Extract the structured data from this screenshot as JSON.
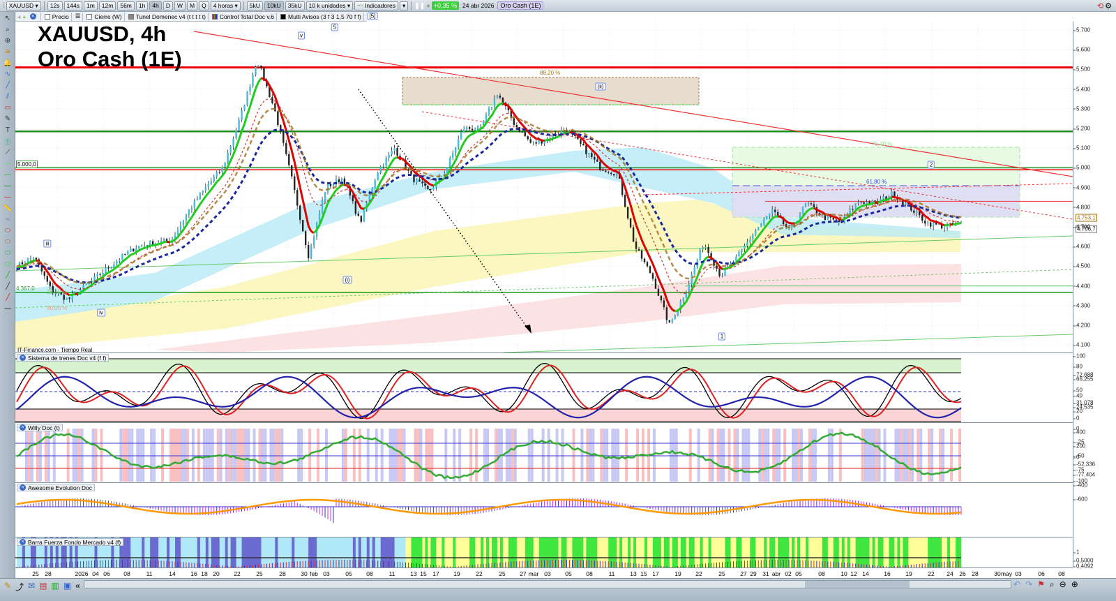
{
  "toolbar": {
    "symbol": "XAUUSD",
    "timeframes": [
      "12s",
      "144s",
      "1m",
      "12m",
      "56m",
      "1h",
      "4h",
      "D",
      "W",
      "M",
      "Q"
    ],
    "active_timeframe": "4h",
    "period": "4 horas",
    "units": [
      "5kU",
      "10kU",
      "35kU"
    ],
    "active_unit": "10kU",
    "unit_select": "10 k unidades",
    "indicators": "Indicadores",
    "change": "+0,35 %",
    "date": "24 abr 2026",
    "instrument": "Oro Cash (1E)"
  },
  "legend_row": {
    "items": [
      "Precio",
      "Cierre (W)",
      "Tunel Domenec v4 (t t t t t)",
      "Control Total Doc v.6",
      "Multi Avisos (3 f 3 1,5 70 f f)"
    ],
    "wave_top": "[5]"
  },
  "title": {
    "line1": "XAUUSD, 4h",
    "line2": "Oro Cash (1E)"
  },
  "source": "IT-Finance.com - Tiempo Real",
  "annotations": {
    "fib_882": "88,20 %",
    "fib_764": "76,40 %",
    "fib_618": "61,80 %",
    "fib_382": "38,20 %",
    "fib_50": "50,00 %",
    "level_5000": "5.000,0",
    "level_4367": "4.367,0",
    "waves": {
      "v": "v",
      "w5": "5",
      "ii": "(ii)",
      "w2": "2",
      "iii": "iii",
      "iv": "iv",
      "i": "(i)",
      "w1": "1"
    }
  },
  "price_axis": {
    "ticks": [
      "5.700",
      "5.600",
      "5.500",
      "5.400",
      "5.300",
      "5.200",
      "5.100",
      "5.000",
      "4.900",
      "4.800",
      "4.700",
      "4.600",
      "4.500",
      "4.400",
      "4.300",
      "4.200",
      "4.100"
    ],
    "tag_upper": "4.753,1",
    "tag_last": "4.706,7"
  },
  "panes": [
    {
      "name": "Sistema de trenes Doc v4 (f f)",
      "ticks": [
        "100",
        "80",
        "72,688",
        "66,255",
        "50",
        "40",
        "31,078",
        "24,535",
        "20",
        "0"
      ]
    },
    {
      "name": "Willy Doc (t)",
      "ticks": [
        "0",
        "-25",
        "-50",
        "-75",
        "-77,404",
        "-100"
      ]
    },
    {
      "name": "Awesome Evolution Doc",
      "ticks": [
        "400",
        "200",
        "0",
        "-52,336",
        "-400",
        "-600"
      ]
    },
    {
      "name": "Barra Fuerza Fondo Mercado v4 (f)",
      "ticks": [
        "1",
        "0,5000",
        "0,4092"
      ]
    }
  ],
  "dates": [
    "25",
    "28",
    "2026",
    "04",
    "06",
    "08",
    "11",
    "14",
    "16",
    "18",
    "20",
    "22",
    "25",
    "28",
    "30",
    "feb",
    "03",
    "05",
    "08",
    "11",
    "13",
    "15",
    "17",
    "19",
    "22",
    "25",
    "27",
    "mar",
    "03",
    "05",
    "08",
    "11",
    "13",
    "15",
    "17",
    "19",
    "22",
    "25",
    "27",
    "29",
    "31",
    "abr",
    "02",
    "05",
    "08",
    "10",
    "12",
    "14",
    "16",
    "19",
    "22",
    "24",
    "26",
    "28",
    "30",
    "may",
    "03",
    "06",
    "08"
  ],
  "colors": {
    "up": "#1fcc1f",
    "down": "#e00000",
    "blue": "#1a2a9c",
    "brown": "#a0701a"
  },
  "chart_data": {
    "type": "candlestick",
    "symbol": "XAUUSD",
    "interval": "4h",
    "ylim": [
      4100,
      5750
    ],
    "closes": [
      4500,
      4550,
      4380,
      4330,
      4400,
      4470,
      4540,
      4600,
      4620,
      4630,
      4780,
      4900,
      5000,
      5250,
      5550,
      5300,
      4950,
      4550,
      4900,
      4950,
      4720,
      4980,
      5100,
      4950,
      4880,
      4990,
      5200,
      5200,
      5380,
      5220,
      5120,
      5150,
      5200,
      5100,
      5000,
      4970,
      4600,
      4450,
      4200,
      4380,
      4620,
      4450,
      4550,
      4680,
      4780,
      4680,
      4820,
      4750,
      4720,
      4830,
      4820,
      4870,
      4800,
      4720,
      4700,
      4720
    ],
    "levels": [
      5510,
      5185,
      5000,
      4990,
      4830,
      4400,
      4367
    ]
  }
}
